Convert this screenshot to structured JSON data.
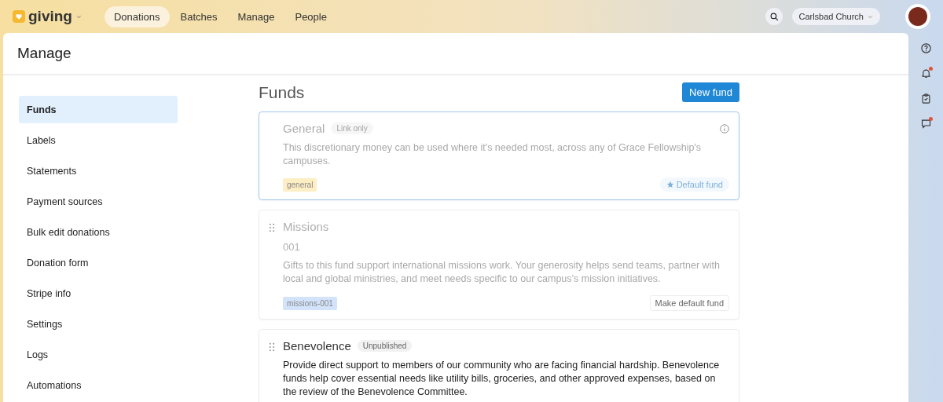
{
  "app": {
    "name": "giving"
  },
  "nav": [
    {
      "label": "Donations",
      "selected": true
    },
    {
      "label": "Batches",
      "selected": false
    },
    {
      "label": "Manage",
      "selected": false
    },
    {
      "label": "People",
      "selected": false
    }
  ],
  "campus": "Carlsbad Church",
  "rail": [
    {
      "kind": "help",
      "badge": false
    },
    {
      "kind": "bell",
      "badge": true
    },
    {
      "kind": "clipboard",
      "badge": false
    },
    {
      "kind": "chat",
      "badge": true
    }
  ],
  "page_title": "Manage",
  "sidebar": {
    "items": [
      {
        "label": "Funds",
        "selected": true
      },
      {
        "label": "Labels",
        "selected": false
      },
      {
        "label": "Statements",
        "selected": false
      },
      {
        "label": "Payment sources",
        "selected": false
      },
      {
        "label": "Bulk edit donations",
        "selected": false
      },
      {
        "label": "Donation form",
        "selected": false
      },
      {
        "label": "Stripe info",
        "selected": false
      },
      {
        "label": "Settings",
        "selected": false
      },
      {
        "label": "Logs",
        "selected": false
      },
      {
        "label": "Automations",
        "selected": false
      }
    ]
  },
  "section_title": "Funds",
  "new_button": "New fund",
  "funds": [
    {
      "name": "General",
      "status": "Link only",
      "description": "This discretionary money can be used where it's needed most, across any of Grace Fellowship's campuses.",
      "tag": "general",
      "color": "#fdeec4",
      "default": {
        "kind": "badge",
        "label": "Default fund"
      },
      "selected": true,
      "faded": true,
      "draggable": false
    },
    {
      "name": "Missions",
      "code": "001",
      "description": "Gifts to this fund support international missions work. Your generosity helps send teams, partner with local and global ministries, and meet needs specific to our campus’s mission initiatives.",
      "tag": "missions-001",
      "color": "#d2e3fb",
      "default": {
        "kind": "button",
        "label": "Make default fund"
      },
      "selected": false,
      "faded": true,
      "draggable": true
    },
    {
      "name": "Benevolence",
      "status": "Unpublished",
      "description": "Provide direct support to members of our community who are facing financial hardship. Benevolence funds help cover essential needs like utility bills, groceries, and other approved expenses, based on the review of the Benevolence Committee.",
      "selected": false,
      "faded": false,
      "draggable": true
    }
  ]
}
